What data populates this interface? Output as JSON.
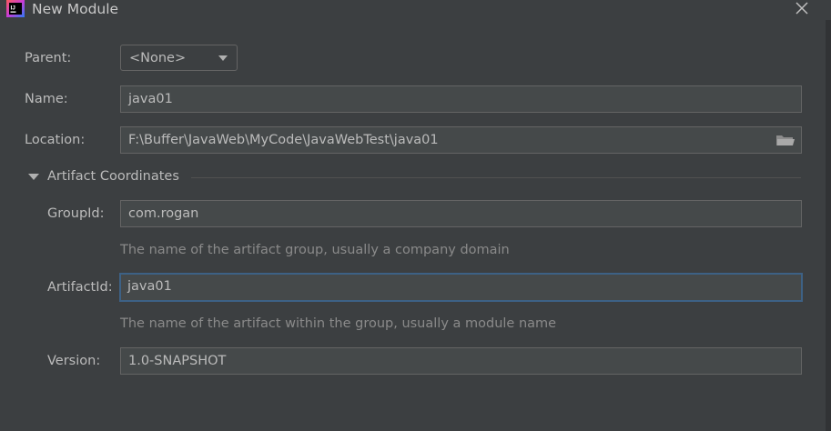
{
  "window": {
    "title": "New Module",
    "app_icon": "intellij-idea-icon",
    "close_icon": "close-icon"
  },
  "form": {
    "parent": {
      "label": "Parent:",
      "value": "<None>"
    },
    "name": {
      "label": "Name:",
      "value": "java01"
    },
    "location": {
      "label": "Location:",
      "value": "F:\\Buffer\\JavaWeb\\MyCode\\JavaWebTest\\java01",
      "browse_icon": "folder-icon"
    }
  },
  "artifact": {
    "section_title": "Artifact Coordinates",
    "expanded": true,
    "group_id": {
      "label": "GroupId:",
      "value": "com.rogan",
      "hint": "The name of the artifact group, usually a company domain"
    },
    "artifact_id": {
      "label": "ArtifactId:",
      "value": "java01",
      "hint": "The name of the artifact within the group, usually a module name"
    },
    "version": {
      "label": "Version:",
      "value": "1.0-SNAPSHOT"
    }
  },
  "colors": {
    "background": "#3c3f41",
    "field_background": "#45494a",
    "field_border": "#646464",
    "focus_border": "#3d6185",
    "text": "#bbbbbb",
    "hint_text": "#8a8a8a"
  }
}
